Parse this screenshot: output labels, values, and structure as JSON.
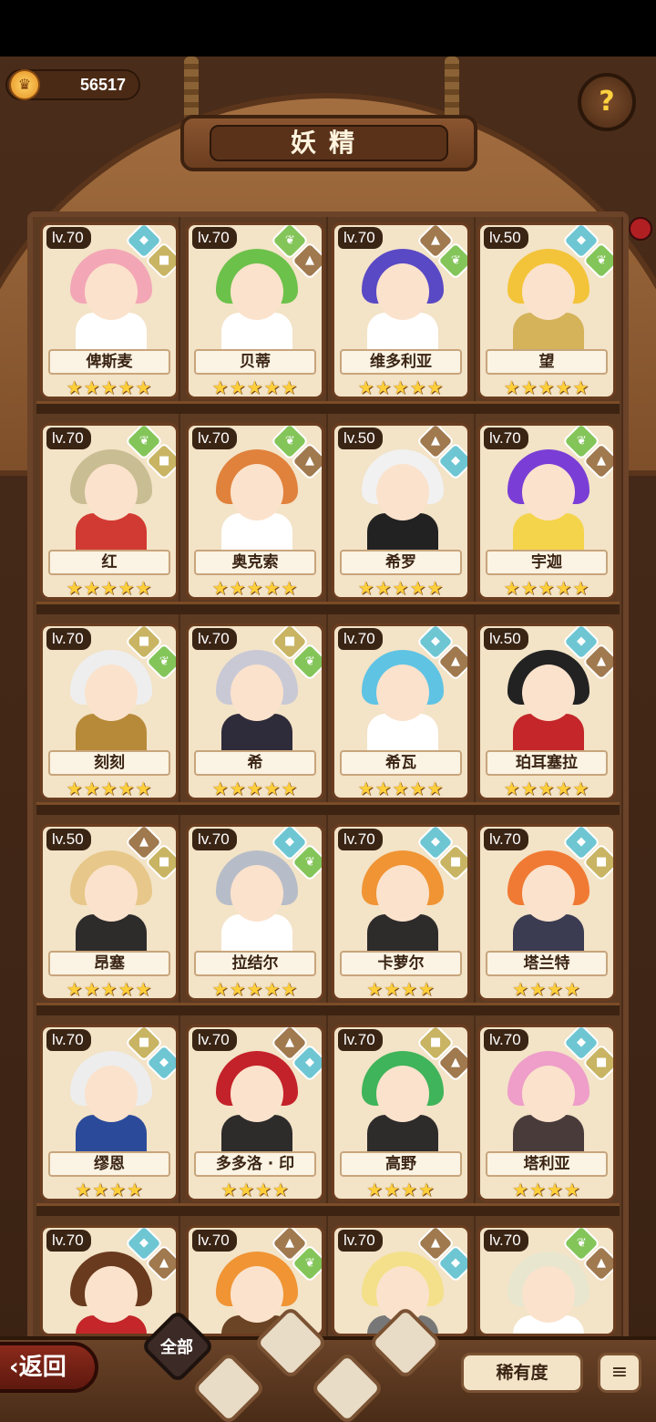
{
  "currency": {
    "value": "56517",
    "icon": "crown-coin-icon"
  },
  "title": "妖精",
  "help": {
    "label": "?"
  },
  "fairies": [
    {
      "name": "俾斯麦",
      "level": "lv.70",
      "stars": 5,
      "elements": [
        "water",
        "earth"
      ],
      "hair": "#f3a7b6",
      "outfit": "#ffffff"
    },
    {
      "name": "贝蒂",
      "level": "lv.70",
      "stars": 5,
      "elements": [
        "plant",
        "rock"
      ],
      "hair": "#6cc14a",
      "outfit": "#ffffff"
    },
    {
      "name": "维多利亚",
      "level": "lv.70",
      "stars": 5,
      "elements": [
        "rock",
        "plant"
      ],
      "hair": "#5a49c4",
      "outfit": "#ffffff"
    },
    {
      "name": "望",
      "level": "lv.50",
      "stars": 5,
      "elements": [
        "water",
        "plant"
      ],
      "hair": "#f3c43a",
      "outfit": "#d4b35a"
    },
    {
      "name": "红",
      "level": "lv.70",
      "stars": 5,
      "elements": [
        "plant",
        "earth"
      ],
      "hair": "#c9bd93",
      "outfit": "#d13a32"
    },
    {
      "name": "奥克索",
      "level": "lv.70",
      "stars": 5,
      "elements": [
        "plant",
        "rock"
      ],
      "hair": "#e0823c",
      "outfit": "#ffffff"
    },
    {
      "name": "希罗",
      "level": "lv.50",
      "stars": 5,
      "elements": [
        "rock",
        "water"
      ],
      "hair": "#f1f1f1",
      "outfit": "#222222"
    },
    {
      "name": "宇迦",
      "level": "lv.70",
      "stars": 5,
      "elements": [
        "plant",
        "rock"
      ],
      "hair": "#7a3ed6",
      "outfit": "#f4d44a"
    },
    {
      "name": "刻刻",
      "level": "lv.70",
      "stars": 5,
      "elements": [
        "earth",
        "plant"
      ],
      "hair": "#eeeeee",
      "outfit": "#b78a39"
    },
    {
      "name": "希",
      "level": "lv.70",
      "stars": 5,
      "elements": [
        "earth",
        "plant"
      ],
      "hair": "#c9c9d6",
      "outfit": "#2e2b3a"
    },
    {
      "name": "希瓦",
      "level": "lv.70",
      "stars": 5,
      "elements": [
        "water",
        "rock"
      ],
      "hair": "#5fc3e4",
      "outfit": "#ffffff"
    },
    {
      "name": "珀耳塞拉",
      "level": "lv.50",
      "stars": 5,
      "elements": [
        "water",
        "rock"
      ],
      "hair": "#222222",
      "outfit": "#c4262a"
    },
    {
      "name": "昂塞",
      "level": "lv.50",
      "stars": 5,
      "elements": [
        "rock",
        "earth"
      ],
      "hair": "#e7c88a",
      "outfit": "#2e2b2b"
    },
    {
      "name": "拉结尔",
      "level": "lv.70",
      "stars": 5,
      "elements": [
        "water",
        "plant"
      ],
      "hair": "#b7bdc8",
      "outfit": "#ffffff"
    },
    {
      "name": "卡萝尔",
      "level": "lv.70",
      "stars": 4,
      "elements": [
        "water",
        "earth"
      ],
      "hair": "#f09434",
      "outfit": "#2e2b2b"
    },
    {
      "name": "塔兰特",
      "level": "lv.70",
      "stars": 4,
      "elements": [
        "water",
        "earth"
      ],
      "hair": "#f07a34",
      "outfit": "#3b3b52"
    },
    {
      "name": "缪恩",
      "level": "lv.70",
      "stars": 4,
      "elements": [
        "earth",
        "water"
      ],
      "hair": "#ededed",
      "outfit": "#2b4b9a"
    },
    {
      "name": "多多洛 · 印",
      "level": "lv.70",
      "stars": 4,
      "elements": [
        "rock",
        "water"
      ],
      "hair": "#c4222a",
      "outfit": "#2e2b2b"
    },
    {
      "name": "高野",
      "level": "lv.70",
      "stars": 4,
      "elements": [
        "earth",
        "rock"
      ],
      "hair": "#3fb45a",
      "outfit": "#2e2b2b"
    },
    {
      "name": "塔利亚",
      "level": "lv.70",
      "stars": 4,
      "elements": [
        "water",
        "earth"
      ],
      "hair": "#ee9ec8",
      "outfit": "#4a3b3b"
    },
    {
      "name": "",
      "level": "lv.70",
      "stars": 0,
      "elements": [
        "water",
        "rock"
      ],
      "hair": "#6a3a1e",
      "outfit": "#c4262a"
    },
    {
      "name": "",
      "level": "lv.70",
      "stars": 0,
      "elements": [
        "rock",
        "plant"
      ],
      "hair": "#f09434",
      "outfit": "#6a4424"
    },
    {
      "name": "",
      "level": "lv.70",
      "stars": 0,
      "elements": [
        "rock",
        "water"
      ],
      "hair": "#f4e08a",
      "outfit": "#777777"
    },
    {
      "name": "",
      "level": "lv.70",
      "stars": 0,
      "elements": [
        "plant",
        "rock"
      ],
      "hair": "#e8e6cf",
      "outfit": "#ffffff"
    }
  ],
  "bottom": {
    "back_label": "返回",
    "filter_all_label": "全部",
    "sort_label": "稀有度",
    "sort_order_icon": "sort-descending-icon"
  },
  "colors": {
    "accent": "#6a3d20",
    "star": "#ffcf3a"
  }
}
